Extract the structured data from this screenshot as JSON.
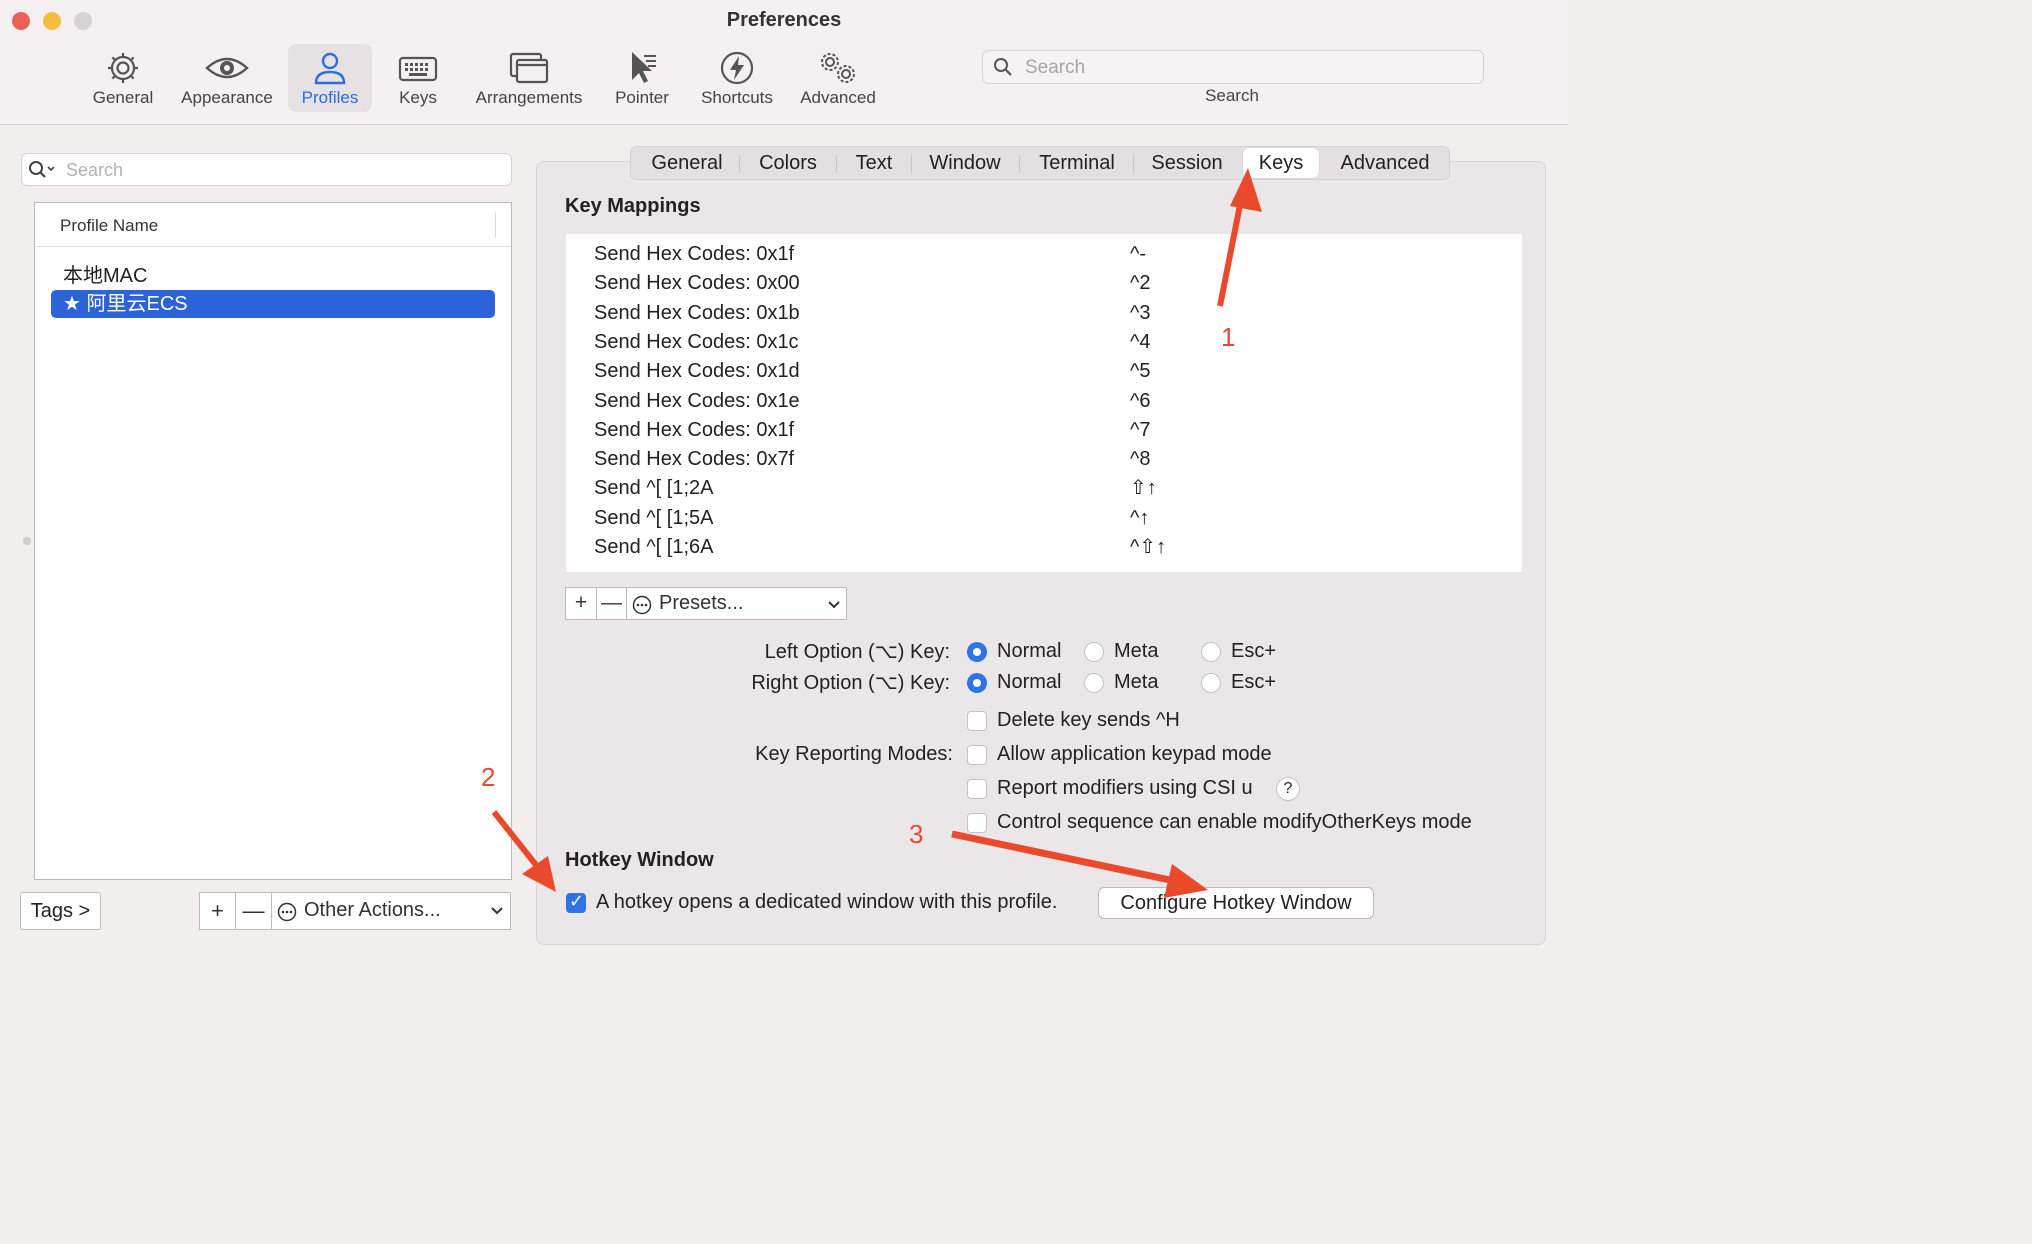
{
  "window": {
    "title": "Preferences"
  },
  "toolbar": {
    "items": [
      {
        "label": "General",
        "icon": "gear-icon"
      },
      {
        "label": "Appearance",
        "icon": "eye-icon"
      },
      {
        "label": "Profiles",
        "icon": "person-icon",
        "selected": true
      },
      {
        "label": "Keys",
        "icon": "keyboard-icon"
      },
      {
        "label": "Arrangements",
        "icon": "window-arrangement-icon"
      },
      {
        "label": "Pointer",
        "icon": "cursor-icon"
      },
      {
        "label": "Shortcuts",
        "icon": "lightning-icon"
      },
      {
        "label": "Advanced",
        "icon": "gears-icon"
      }
    ],
    "search": {
      "placeholder": "Search",
      "caption": "Search"
    }
  },
  "profiles": {
    "search_placeholder": "Search",
    "column_header": "Profile Name",
    "items": [
      {
        "name": "本地MAC",
        "selected": false
      },
      {
        "name": "★ 阿里云ECS",
        "selected": true
      }
    ],
    "tags_button": "Tags >",
    "add": "+",
    "remove": "—",
    "other_actions": "Other Actions..."
  },
  "tabs": {
    "items": [
      "General",
      "Colors",
      "Text",
      "Window",
      "Terminal",
      "Session",
      "Keys",
      "Advanced"
    ],
    "selected": "Keys"
  },
  "key_mappings": {
    "heading": "Key Mappings",
    "rows": [
      {
        "action": "Send Hex Codes: 0x1f",
        "key": "^-"
      },
      {
        "action": "Send Hex Codes: 0x00",
        "key": "^2"
      },
      {
        "action": "Send Hex Codes: 0x1b",
        "key": "^3"
      },
      {
        "action": "Send Hex Codes: 0x1c",
        "key": "^4"
      },
      {
        "action": "Send Hex Codes: 0x1d",
        "key": "^5"
      },
      {
        "action": "Send Hex Codes: 0x1e",
        "key": "^6"
      },
      {
        "action": "Send Hex Codes: 0x1f",
        "key": "^7"
      },
      {
        "action": "Send Hex Codes: 0x7f",
        "key": "^8"
      },
      {
        "action": "Send ^[ [1;2A",
        "key": "⇧↑"
      },
      {
        "action": "Send ^[ [1;5A",
        "key": "^↑"
      },
      {
        "action": "Send ^[ [1;6A",
        "key": "^⇧↑"
      }
    ],
    "add": "+",
    "remove": "—",
    "presets": "Presets..."
  },
  "options": {
    "left_option_label": "Left Option (⌥) Key:",
    "right_option_label": "Right Option (⌥) Key:",
    "choices": [
      "Normal",
      "Meta",
      "Esc+"
    ],
    "left_selected": "Normal",
    "right_selected": "Normal",
    "key_reporting_label": "Key Reporting Modes:",
    "delete_sends_h": {
      "label": "Delete key sends ^H",
      "checked": false
    },
    "app_keypad": {
      "label": "Allow application keypad mode",
      "checked": false
    },
    "csi_u": {
      "label": "Report modifiers using CSI u",
      "checked": false
    },
    "help": "?",
    "modify_other_keys": {
      "label": "Control sequence can enable modifyOtherKeys mode",
      "checked": false
    }
  },
  "hotkey": {
    "heading": "Hotkey Window",
    "checkbox_label": "A hotkey opens a dedicated window with this profile.",
    "checked": true,
    "configure_button": "Configure Hotkey Window"
  },
  "annotations": {
    "one": "1",
    "two": "2",
    "three": "3",
    "color": "#e94a2c"
  }
}
